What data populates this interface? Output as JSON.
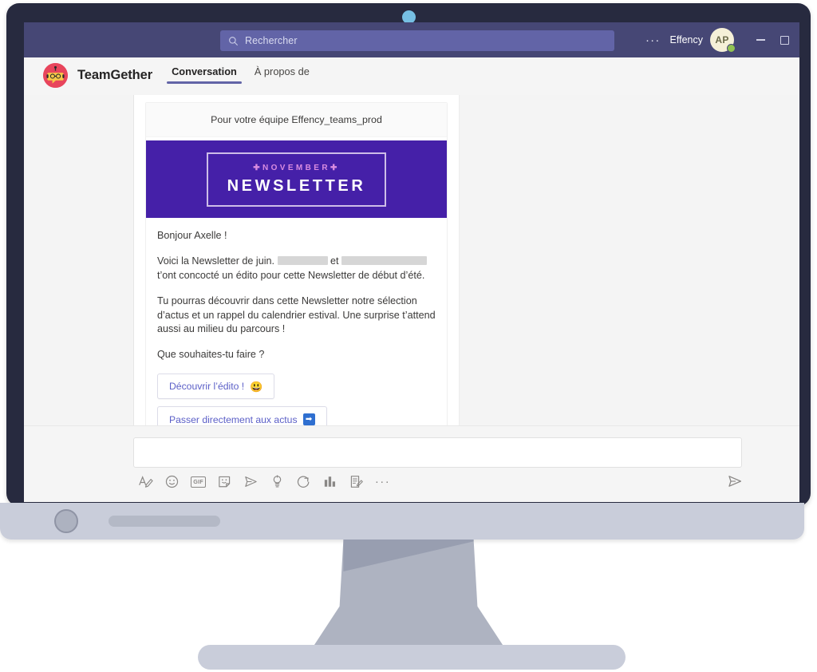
{
  "window": {
    "search": {
      "placeholder": "Rechercher",
      "icon": "search-icon"
    },
    "overflow_label": "···",
    "account_name": "Effency",
    "avatar_initials": "AP",
    "presence": "available",
    "minimize_label": "—",
    "maximize_label": "☐",
    "accent_color": "#464775",
    "search_bg": "#6264a7"
  },
  "app_bar": {
    "logo_icon": "teamgether-robot-logo",
    "title": "TeamGether",
    "tabs": [
      {
        "label": "Conversation",
        "active": true
      },
      {
        "label": "À propos de",
        "active": false
      }
    ],
    "active_underline_color": "#6264a7"
  },
  "message_card": {
    "team_line": "Pour votre équipe Effency_teams_prod",
    "hero": {
      "month": "✚NOVEMBER✚",
      "word": "NEWSLETTER",
      "bg_color": "#4520a8",
      "month_color": "#d98ce0"
    },
    "greeting": "Bonjour Axelle !",
    "paragraph_1_before": "Voici la Newsletter de juin.",
    "paragraph_1_middle": "et",
    "paragraph_1_after": "t’ont concocté un édito pour cette Newsletter de début d’été.",
    "redacted_1": "",
    "redacted_2": "",
    "paragraph_2": "Tu pourras découvrir dans cette Newsletter notre sélection d’actus et un rappel du calendrier estival. Une surprise t’attend aussi au milieu du parcours !",
    "question": "Que souhaites-tu faire ?",
    "buttons": [
      {
        "label": "Découvrir l’édito !",
        "emoji": "😃",
        "emoji_name": "grinning-face-emoji"
      },
      {
        "label": "Passer directement aux actus",
        "emoji": "➡",
        "emoji_name": "right-arrow-emoji"
      }
    ],
    "link_color": "#5b5fc7"
  },
  "compose": {
    "input_value": "",
    "input_placeholder": "",
    "toolbar_icons": [
      "format-text-icon",
      "emoji-icon",
      "gif-icon",
      "sticker-icon",
      "send-file-icon",
      "praise-icon",
      "loop-icon",
      "poll-icon",
      "notes-icon",
      "more-options-icon"
    ],
    "gif_label": "GIF",
    "more_label": "···",
    "send_icon": "send-icon"
  },
  "device": {
    "frame_color": "#272a3f",
    "chin_color": "#c9cdda",
    "stand_color": "#aeb3c1",
    "webcam_color": "#76bfe3"
  }
}
